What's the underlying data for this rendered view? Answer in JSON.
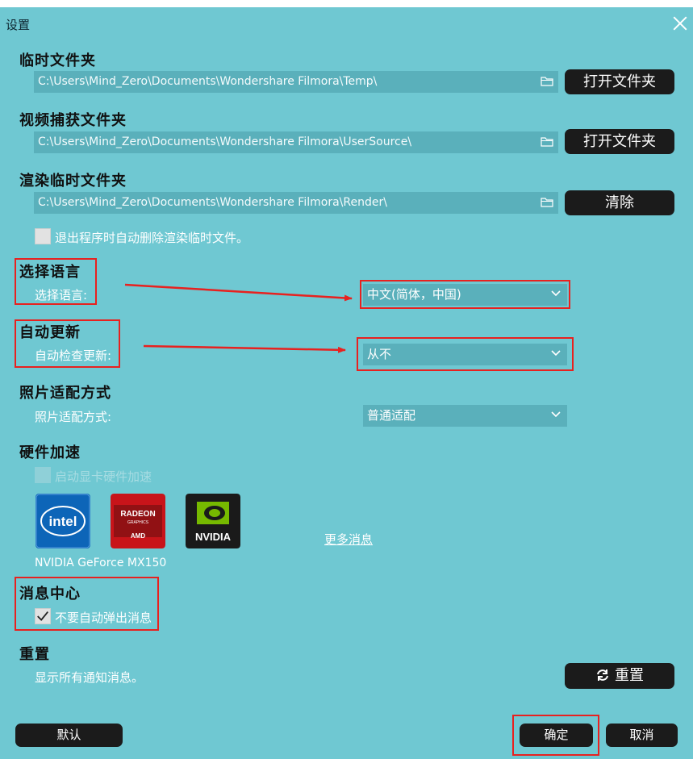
{
  "window": {
    "title": "设置"
  },
  "temp_folder": {
    "heading": "临时文件夹",
    "path": "C:\\Users\\Mind_Zero\\Documents\\Wondershare Filmora\\Temp\\",
    "button": "打开文件夹"
  },
  "capture_folder": {
    "heading": "视频捕获文件夹",
    "path": "C:\\Users\\Mind_Zero\\Documents\\Wondershare Filmora\\UserSource\\",
    "button": "打开文件夹"
  },
  "render_folder": {
    "heading": "渲染临时文件夹",
    "path": "C:\\Users\\Mind_Zero\\Documents\\Wondershare Filmora\\Render\\",
    "button": "清除",
    "auto_delete_label": "退出程序时自动删除渲染临时文件。",
    "auto_delete_checked": false
  },
  "language": {
    "heading": "选择语言",
    "label": "选择语言:",
    "selected": "中文(简体，中国)"
  },
  "auto_update": {
    "heading": "自动更新",
    "label": "自动检查更新:",
    "selected": "从不"
  },
  "photo_fit": {
    "heading": "照片适配方式",
    "label": "照片适配方式:",
    "selected": "普通适配"
  },
  "hardware": {
    "heading": "硬件加速",
    "enable_label": "启动显卡硬件加速",
    "enable_checked": false,
    "vendors": [
      {
        "name": "intel",
        "logo_text": "intel"
      },
      {
        "name": "amd",
        "logo_text": "RADEON",
        "logo_sub": "GRAPHICS",
        "logo_brand": "AMD"
      },
      {
        "name": "nvidia",
        "logo_text": "NVIDIA"
      }
    ],
    "more_link": "更多消息",
    "gpu_name": "NVIDIA GeForce MX150"
  },
  "message_center": {
    "heading": "消息中心",
    "no_popup_label": "不要自动弹出消息",
    "no_popup_checked": true
  },
  "reset": {
    "heading": "重置",
    "label": "显示所有通知消息。",
    "button": "重置"
  },
  "footer": {
    "default_button": "默认",
    "ok_button": "确定",
    "cancel_button": "取消"
  },
  "colors": {
    "background": "#6fc8d2",
    "field": "#5ab0bb",
    "button": "#1b1b1b",
    "annotation": "#e8211f"
  }
}
